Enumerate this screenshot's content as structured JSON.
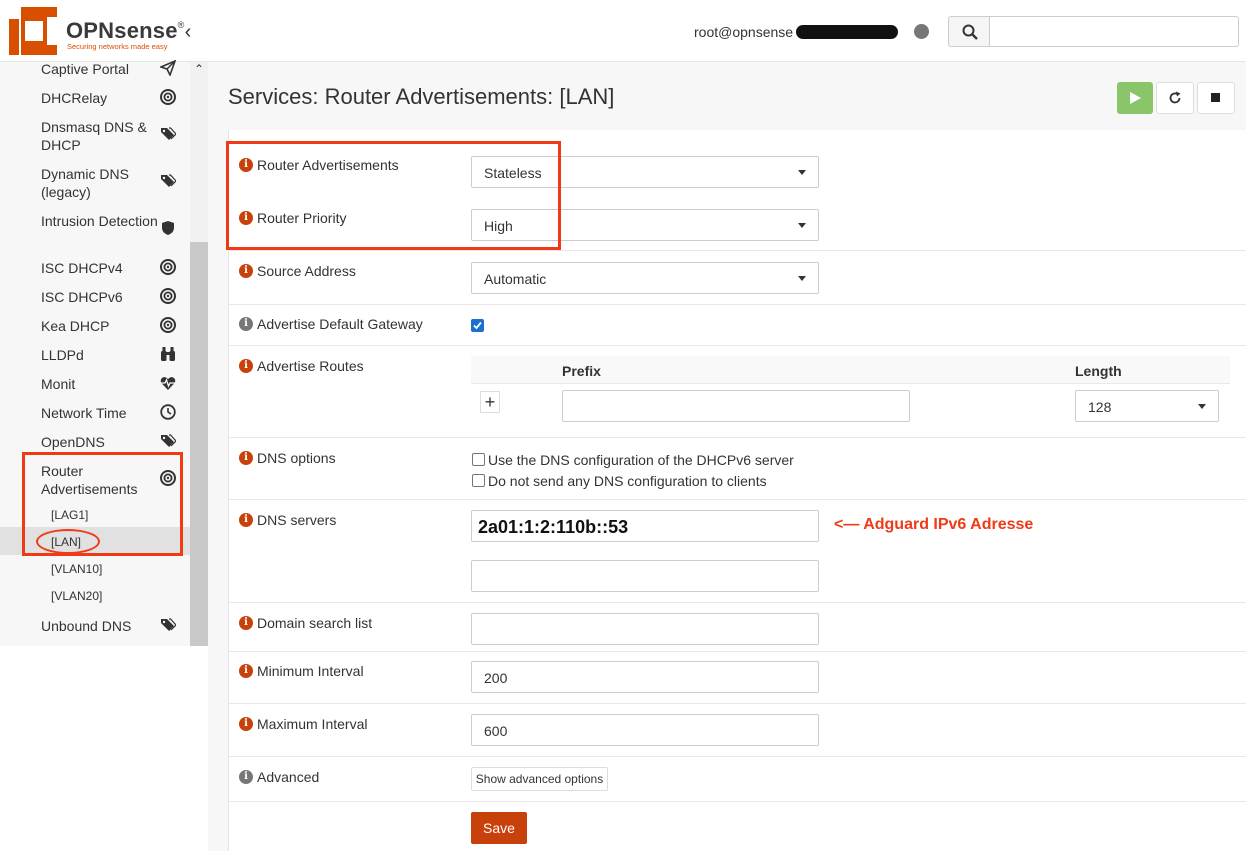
{
  "brand": {
    "name": "OPNsense",
    "trademark": "®",
    "tagline": "Securing networks made easy",
    "accent": "#d94f00"
  },
  "header": {
    "user": "root@opnsense",
    "collapse_icon": "chevron-left-icon",
    "search_icon": "magnifier-icon",
    "search_placeholder": ""
  },
  "sidebar": {
    "items": [
      {
        "label": "Captive Portal",
        "icon": "paper-plane-icon"
      },
      {
        "label": "DHCRelay",
        "icon": "bullseye-icon"
      },
      {
        "label": "Dnsmasq DNS & DHCP",
        "icon": "tags-icon"
      },
      {
        "label": "Dynamic DNS (legacy)",
        "icon": "tags-icon"
      },
      {
        "label": "Intrusion Detection",
        "icon": "shield-icon"
      },
      {
        "label": "ISC DHCPv4",
        "icon": "bullseye-icon"
      },
      {
        "label": "ISC DHCPv6",
        "icon": "bullseye-icon"
      },
      {
        "label": "Kea DHCP",
        "icon": "bullseye-icon"
      },
      {
        "label": "LLDPd",
        "icon": "binoculars-icon"
      },
      {
        "label": "Monit",
        "icon": "heartbeat-icon"
      },
      {
        "label": "Network Time",
        "icon": "clock-icon"
      },
      {
        "label": "OpenDNS",
        "icon": "tags-icon"
      },
      {
        "label": "Router Advertisements",
        "icon": "bullseye-icon"
      },
      {
        "label": "Unbound DNS",
        "icon": "tags-icon"
      }
    ],
    "subitems": [
      "[LAG1]",
      "[LAN]",
      "[VLAN10]",
      "[VLAN20]"
    ],
    "active_subitem": "[LAN]"
  },
  "page": {
    "title": "Services: Router Advertisements: [LAN]"
  },
  "form": {
    "router_advertisements": {
      "label": "Router Advertisements",
      "value": "Stateless"
    },
    "router_priority": {
      "label": "Router Priority",
      "value": "High"
    },
    "source_address": {
      "label": "Source Address",
      "value": "Automatic"
    },
    "advertise_default_gateway": {
      "label": "Advertise Default Gateway",
      "checked": true
    },
    "advertise_routes": {
      "label": "Advertise Routes",
      "col_prefix": "Prefix",
      "col_length": "Length",
      "length_value": "128",
      "prefix_value": "",
      "add_label": "+"
    },
    "dns_options": {
      "label": "DNS options",
      "option1": "Use the DNS configuration of the DHCPv6 server",
      "option2": "Do not send any DNS configuration to clients"
    },
    "dns_servers": {
      "label": "DNS servers",
      "value1": "2a01:1:2:110b::53",
      "value2": ""
    },
    "domain_search_list": {
      "label": "Domain search list",
      "value": ""
    },
    "minimum_interval": {
      "label": "Minimum Interval",
      "value": "200"
    },
    "maximum_interval": {
      "label": "Maximum Interval",
      "value": "600"
    },
    "advanced": {
      "label": "Advanced",
      "button": "Show advanced options"
    },
    "save": "Save"
  },
  "annotation": {
    "text": "<— Adguard IPv6 Adresse",
    "color": "#f03a17"
  },
  "colors": {
    "primary": "#c8410b",
    "play": "#8bc56a",
    "checkbox": "#1a6fd1"
  }
}
